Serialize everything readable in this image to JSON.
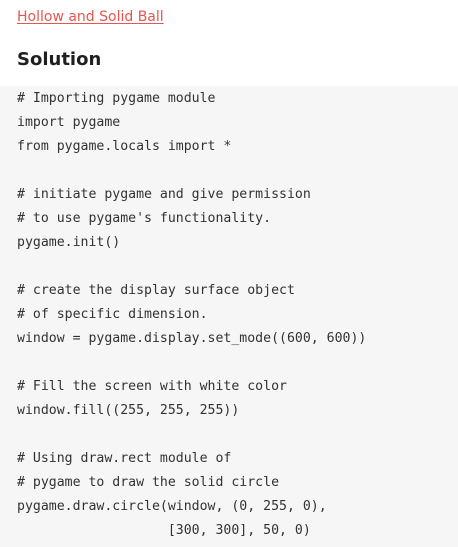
{
  "header": {
    "link_text": "Hollow and Solid Ball",
    "title": "Solution"
  },
  "code": {
    "lines": [
      "# Importing pygame module",
      "import pygame",
      "from pygame.locals import *",
      "",
      "# initiate pygame and give permission",
      "# to use pygame's functionality.",
      "pygame.init()",
      "",
      "# create the display surface object",
      "# of specific dimension.",
      "window = pygame.display.set_mode((600, 600))",
      "",
      "# Fill the screen with white color",
      "window.fill((255, 255, 255))",
      "",
      "# Using draw.rect module of",
      "# pygame to draw the solid circle",
      "pygame.draw.circle(window, (0, 255, 0),",
      "                   [300, 300], 50, 0)"
    ]
  },
  "colors": {
    "link": "#e8554e",
    "title": "#1f1f1f",
    "code_text": "#323232",
    "code_background": "#f6f6f6"
  }
}
